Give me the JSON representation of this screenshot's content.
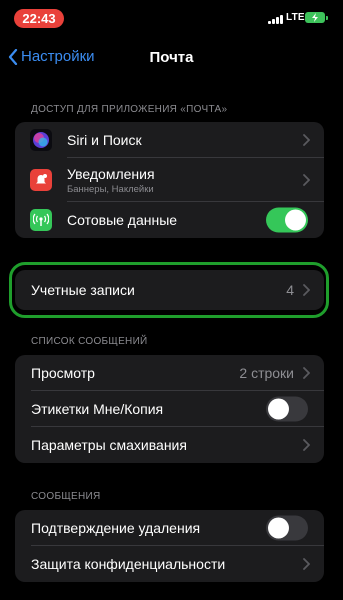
{
  "status_bar": {
    "time": "22:43",
    "network": "LTE"
  },
  "nav": {
    "back_label": "Настройки",
    "title": "Почта"
  },
  "sections": {
    "access": {
      "header": "ДОСТУП ДЛЯ ПРИЛОЖЕНИЯ «ПОЧТА»",
      "items": [
        {
          "label": "Siri и Поиск",
          "icon": "siri-icon",
          "color": "#5b3fd6"
        },
        {
          "label": "Уведомления",
          "sublabel": "Баннеры, Наклейки",
          "icon": "notifications-icon",
          "color": "#e9413a"
        },
        {
          "label": "Сотовые данные",
          "icon": "cellular-icon",
          "color": "#35c759",
          "toggle": true
        }
      ]
    },
    "accounts": {
      "label": "Учетные записи",
      "value": "4"
    },
    "message_list": {
      "header": "СПИСОК СООБЩЕНИЙ",
      "items": [
        {
          "label": "Просмотр",
          "value": "2 строки"
        },
        {
          "label": "Этикетки Мне/Копия",
          "toggle": false
        },
        {
          "label": "Параметры смахивания"
        }
      ]
    },
    "messages": {
      "header": "СООБЩЕНИЯ",
      "items": [
        {
          "label": "Подтверждение удаления",
          "toggle": false
        },
        {
          "label": "Защита конфиденциальности"
        }
      ]
    }
  },
  "colors": {
    "accent": "#3b8cf0",
    "toggle_on": "#35c759",
    "highlight": "#1f9e2c",
    "cell_bg": "#1c1c1e"
  }
}
